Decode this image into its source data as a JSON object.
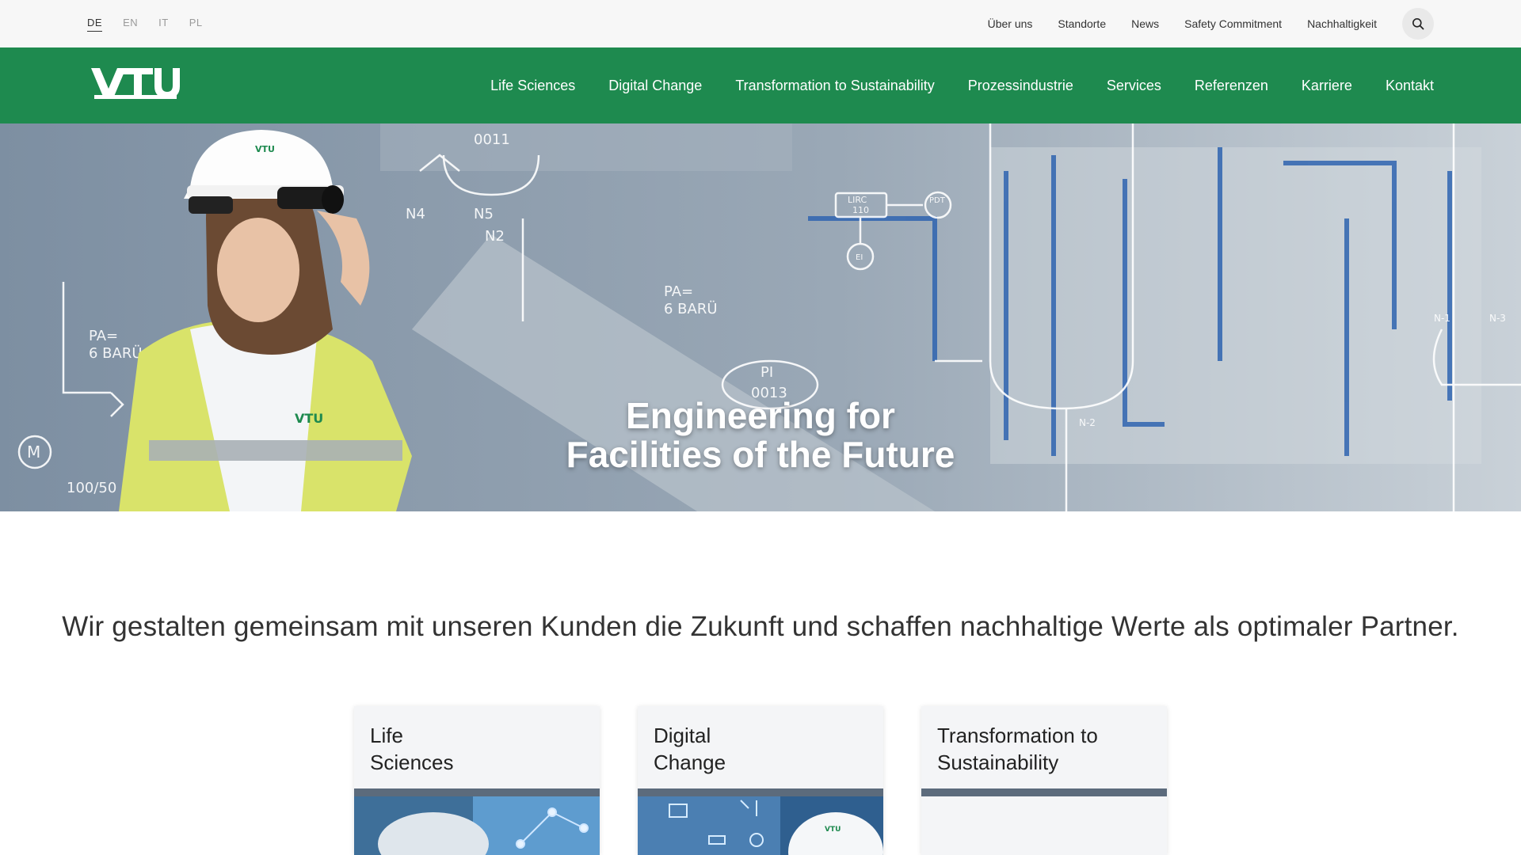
{
  "languages": [
    {
      "code": "DE",
      "active": true
    },
    {
      "code": "EN",
      "active": false
    },
    {
      "code": "IT",
      "active": false
    },
    {
      "code": "PL",
      "active": false
    }
  ],
  "utility_links": [
    "Über uns",
    "Standorte",
    "News",
    "Safety Commitment",
    "Nachhaltigkeit"
  ],
  "search": {
    "icon": "search-icon"
  },
  "brand": {
    "logo_text": "VTU",
    "primary_color": "#1e8a4f"
  },
  "main_nav": [
    "Life Sciences",
    "Digital Change",
    "Transformation to Sustainability",
    "Prozessindustrie",
    "Services",
    "Referenzen",
    "Karriere",
    "Kontakt"
  ],
  "hero": {
    "title_line1": "Engineering for",
    "title_line2": "Facilities of the Future",
    "diagram_labels": [
      "0011",
      "N4",
      "N5",
      "N2",
      "PA=",
      "6 BARÜ",
      "PI",
      "0013",
      "100/50",
      "LIRC",
      "110",
      "PDT",
      "EI",
      "N-2",
      "N-1",
      "N-3",
      "M"
    ]
  },
  "intro": "Wir gestalten gemeinsam mit unseren Kunden die Zukunft und schaffen nachhaltige Werte als optimaler Partner.",
  "cards": [
    {
      "line1": "Life",
      "line2": "Sciences"
    },
    {
      "line1": "Digital",
      "line2": "Change"
    },
    {
      "line1": "Transformation to",
      "line2": "Sustainability"
    }
  ]
}
